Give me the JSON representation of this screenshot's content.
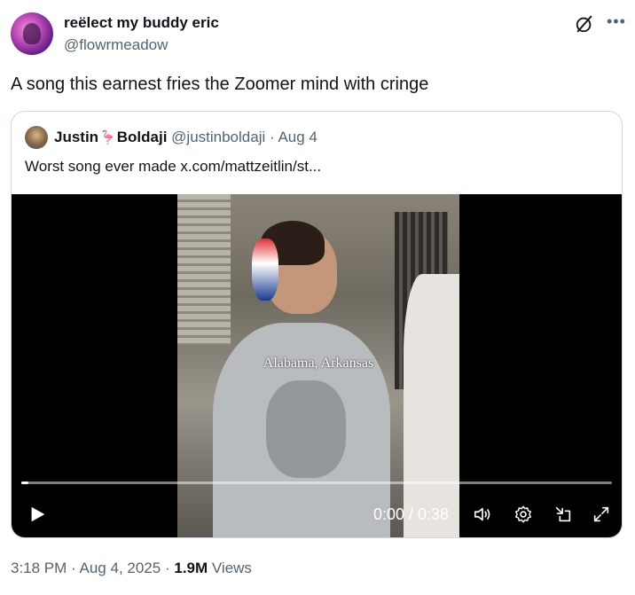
{
  "author": {
    "name": "reëlect my buddy eric",
    "handle": "@flowrmeadow"
  },
  "tweet": {
    "text": "A song this earnest fries the Zoomer mind with cringe"
  },
  "quote": {
    "name_part1": "Justin",
    "name_part2": "Boldaji",
    "handle": "@justinboldaji",
    "separator": "·",
    "date": "Aug 4",
    "text": "Worst song ever made  x.com/mattzeitlin/st..."
  },
  "video": {
    "caption": "Alabama, Arkansas",
    "time": "0:00 / 0:38",
    "progress": 0.012
  },
  "footer": {
    "time": "3:18 PM",
    "dot1": "·",
    "date": "Aug 4, 2025",
    "dot2": "·",
    "views_count": "1.9M",
    "views_label": "Views"
  },
  "icons": {
    "grok": "grok-icon",
    "more": "more-icon",
    "play": "play-icon",
    "volume": "volume-icon",
    "settings": "settings-icon",
    "minimize": "minimize-icon",
    "fullscreen": "fullscreen-icon",
    "flamingo": "flamingo-emoji"
  },
  "colors": {
    "text": "#0f1419",
    "secondary": "#536471",
    "border": "#cfd9de"
  }
}
